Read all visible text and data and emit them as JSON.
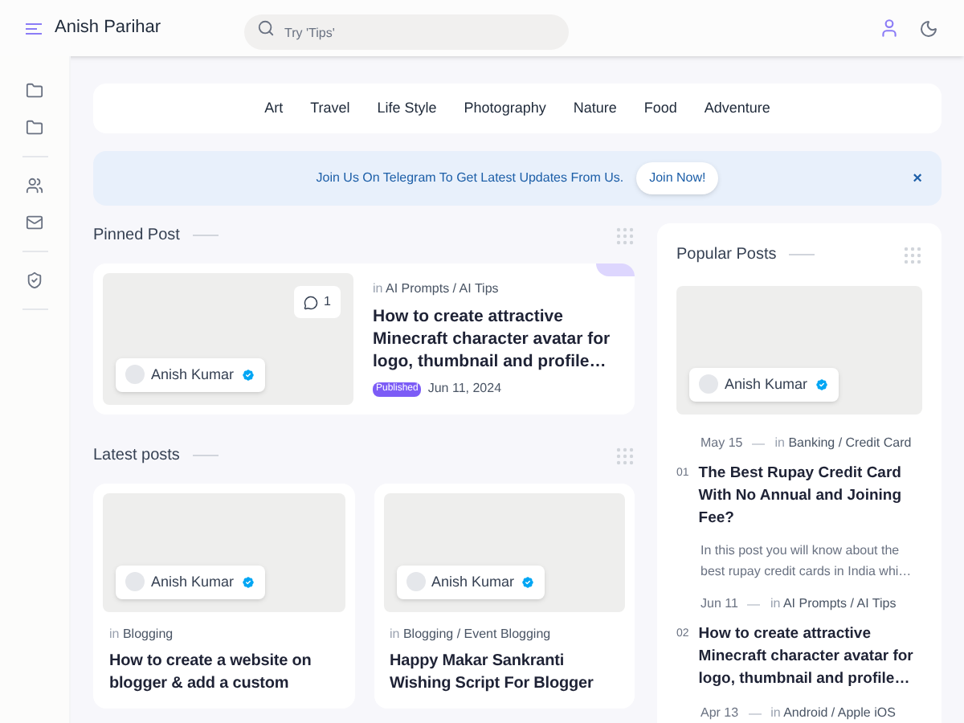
{
  "header": {
    "title": "Anish Parihar",
    "search": {
      "placeholder": "Try 'Tips'"
    }
  },
  "categories": [
    "Art",
    "Travel",
    "Life Style",
    "Photography",
    "Nature",
    "Food",
    "Adventure"
  ],
  "banner": {
    "text": "Join Us On Telegram To Get Latest Updates From Us.",
    "button": "Join Now!",
    "close": "×"
  },
  "pinned": {
    "heading": "Pinned Post",
    "comments": "1",
    "author": "Anish Kumar",
    "category_prefix": "in",
    "category": "AI Prompts / AI Tips",
    "title": "How to create attractive Minecraft character avatar for logo, thumbnail and profile…",
    "badge": "Published",
    "date": "Jun 11, 2024"
  },
  "latest": {
    "heading": "Latest posts",
    "posts": [
      {
        "author": "Anish Kumar",
        "category_prefix": "in",
        "category": "Blogging",
        "title": "How to create a website on blogger & add a custom"
      },
      {
        "author": "Anish Kumar",
        "category_prefix": "in",
        "category": "Blogging / Event Blogging",
        "title": "Happy Makar Sankranti Wishing Script For Blogger"
      }
    ]
  },
  "popular": {
    "heading": "Popular Posts",
    "author": "Anish Kumar",
    "posts": [
      {
        "number": "01",
        "date": "May 15",
        "category_prefix": "in",
        "category": "Banking / Credit Card",
        "title": "The Best Rupay Credit Card With No Annual and Joining Fee?",
        "excerpt": "In this post you will know about the best rupay credit cards in India whi…"
      },
      {
        "number": "02",
        "date": "Jun 11",
        "category_prefix": "in",
        "category": "AI Prompts / AI Tips",
        "title": "How to create attractive Minecraft character avatar for logo, thumbnail and profile…"
      },
      {
        "date": "Apr 13",
        "category_prefix": "in",
        "category": "Android / Apple iOS"
      }
    ]
  }
}
